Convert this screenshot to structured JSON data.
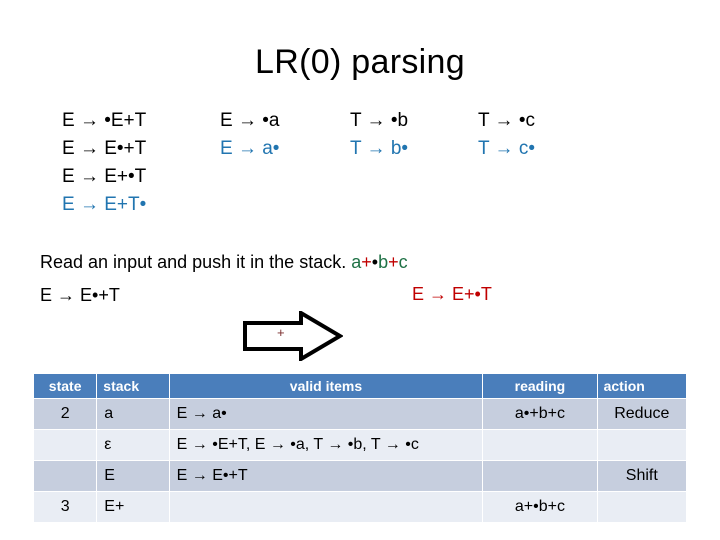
{
  "slide": {
    "title": "LR(0) parsing"
  },
  "items_grid": {
    "columns": [
      {
        "name": "column-e-productions",
        "cells": [
          {
            "text": "E → •E+T",
            "color": "black"
          },
          {
            "text": "E → E•+T",
            "color": "black"
          },
          {
            "text": "E → E+•T",
            "color": "black"
          },
          {
            "text": "E → E+T•",
            "color": "blue"
          }
        ]
      },
      {
        "name": "column-e-a",
        "cells": [
          {
            "text": "E → •a",
            "color": "black"
          },
          {
            "text": "E → a•",
            "color": "blue"
          },
          {
            "text": "",
            "color": "black"
          },
          {
            "text": "",
            "color": "black"
          }
        ]
      },
      {
        "name": "column-t-b",
        "cells": [
          {
            "text": "T → •b",
            "color": "black"
          },
          {
            "text": "T → b•",
            "color": "blue"
          },
          {
            "text": "",
            "color": "black"
          },
          {
            "text": "",
            "color": "black"
          }
        ]
      },
      {
        "name": "column-t-c",
        "cells": [
          {
            "text": "T → •c",
            "color": "black"
          },
          {
            "text": "T → c•",
            "color": "blue"
          },
          {
            "text": "",
            "color": "black"
          },
          {
            "text": "",
            "color": "black"
          }
        ]
      }
    ]
  },
  "read_line": {
    "instruction": "Read an input and push it in the stack.",
    "input_tokens": [
      {
        "text": "a",
        "color": "green"
      },
      {
        "text": "+",
        "color": "red"
      },
      {
        "text": "•",
        "color": "black"
      },
      {
        "text": "b",
        "color": "green"
      },
      {
        "text": "+",
        "color": "red"
      },
      {
        "text": "c",
        "color": "green"
      }
    ]
  },
  "left_item": "E → E•+T",
  "right_item": "E → E+•T",
  "arrow": {
    "label": "+"
  },
  "table": {
    "headers": [
      "state",
      "stack",
      "valid items",
      "reading",
      "action"
    ],
    "rows": [
      {
        "state": "2",
        "stack": "a",
        "valid_items": "E → a•",
        "reading": "a•+b+c",
        "action": "Reduce"
      },
      {
        "state": "",
        "stack": "ε",
        "valid_items": "E → •E+T, E → •a, T → •b, T → •c",
        "reading": "",
        "action": ""
      },
      {
        "state": "",
        "stack": "E",
        "valid_items": "E → E•+T",
        "reading": "",
        "action": "Shift"
      },
      {
        "state": "3",
        "stack": "E+",
        "valid_items": "",
        "reading": "a+•b+c",
        "action": ""
      }
    ]
  },
  "colors": {
    "header_blue": "#4A7EBB",
    "row_dark": "#C6CEDE",
    "row_light": "#E9EDF4",
    "item_blue": "#2175B0",
    "token_green": "#1E7145",
    "token_red": "#C00000",
    "arrow_plus": "#7A2B2B"
  }
}
